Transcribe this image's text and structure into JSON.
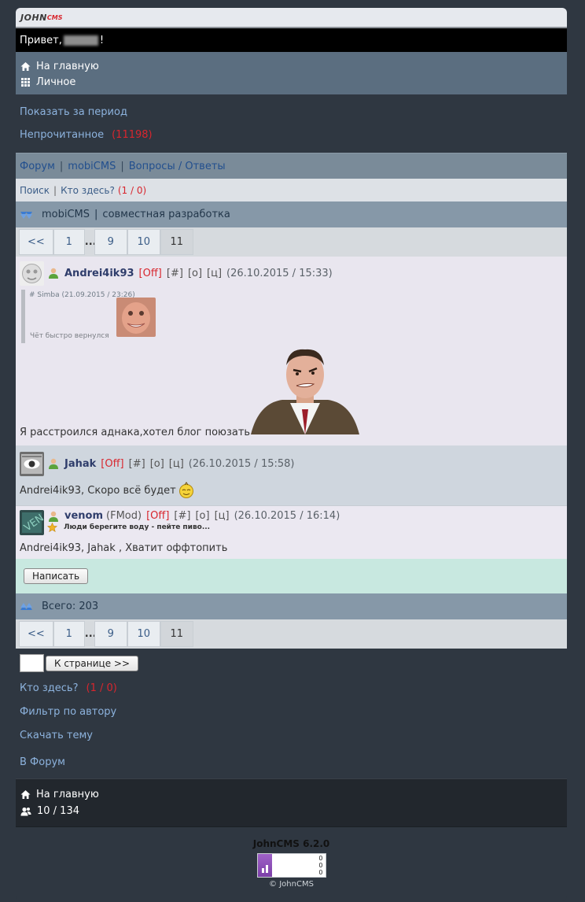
{
  "logo": {
    "john": "JOHN",
    "cms": "CMS"
  },
  "greeting": {
    "prefix": "Привет,",
    "suffix": "!"
  },
  "top_nav": {
    "home": "На главную",
    "personal": "Личное"
  },
  "links": {
    "period": "Показать за период",
    "unread": "Непрочитанное",
    "unread_count": "(11198)"
  },
  "breadcrumb": {
    "forum": "Форум",
    "mobicms": "mobiCMS",
    "qa": "Вопросы / Ответы"
  },
  "search_bar": {
    "search": "Поиск",
    "who": "Кто здесь?",
    "count": "(1 / 0)"
  },
  "topic": {
    "section": "mobiCMS",
    "title": "совместная разработка"
  },
  "pager": {
    "prev": "<<",
    "p1": "1",
    "dots": "...",
    "p9": "9",
    "p10": "10",
    "p11": "11"
  },
  "posts": [
    {
      "nick": "Andrei4ik93",
      "status": "[Off]",
      "hash": "[#]",
      "o": "[о]",
      "c": "[ц]",
      "date": "(26.10.2015 / 15:33)",
      "quote": {
        "author": "# Simba (21.09.2015 / 23:26)",
        "text": "Чёт быстро вернулся"
      },
      "text": "Я расстроился аднака,хотел блог поюзать"
    },
    {
      "nick": "Jahak",
      "status": "[Off]",
      "hash": "[#]",
      "o": "[о]",
      "c": "[ц]",
      "date": "(26.10.2015 / 15:58)",
      "text": "Andrei4ik93, Скоро всё будет"
    },
    {
      "nick": "venom",
      "role": "(FMod)",
      "status": "[Off]",
      "hash": "[#]",
      "o": "[о]",
      "c": "[ц]",
      "date": "(26.10.2015 / 16:14)",
      "signature": "Люди берегите воду - пейте пиво...",
      "text": "Andrei4ik93, Jahak , Хватит оффтопить"
    }
  ],
  "write_button": "Написать",
  "total": "Всего: 203",
  "goto_button": "К странице >>",
  "bottom_links": {
    "who": "Кто здесь?",
    "who_count": "(1 / 0)",
    "filter": "Фильтр по автору",
    "download": "Скачать тему",
    "forum": "В Форум"
  },
  "bottom_nav": {
    "home": "На главную",
    "online": "10 / 134"
  },
  "footer": {
    "version": "JohnCMS 6.2.0",
    "copyright": "© JohnCMS",
    "counter": [
      "0",
      "0",
      "0"
    ]
  },
  "colors": {
    "accent_red": "#d8262e",
    "link_light": "#8db3de",
    "link_dark": "#224f8e",
    "page_bg": "#2f3741"
  }
}
